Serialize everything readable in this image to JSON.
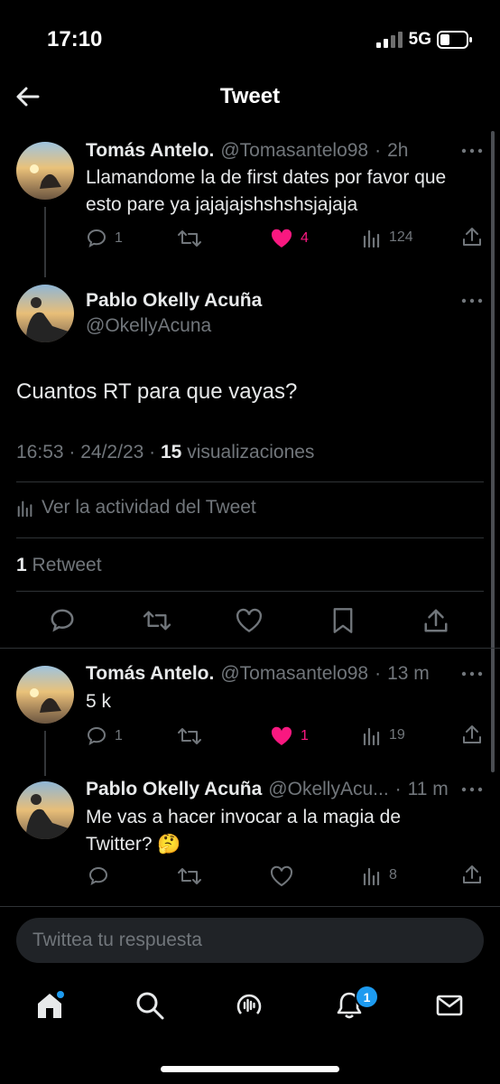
{
  "status": {
    "time": "17:10",
    "network": "5G"
  },
  "header": {
    "title": "Tweet"
  },
  "tweet1": {
    "name": "Tomás Antelo.",
    "handle": "@Tomasantelo98",
    "sep": "·",
    "time": "2h",
    "text": "Llamandome la de first dates por favor que esto pare ya jajajajshshshsjajaja",
    "replies": "1",
    "likes": "4",
    "views": "124"
  },
  "main": {
    "name": "Pablo Okelly Acuña",
    "handle": "@OkellyAcuna",
    "text": "Cuantos RT para que vayas?",
    "time": "16:53",
    "date": "24/2/23",
    "views_count": "15",
    "views_label": "visualizaciones",
    "activity": "Ver la actividad del Tweet",
    "retweets_count": "1",
    "retweets_label": "Retweet"
  },
  "reply1": {
    "name": "Tomás Antelo.",
    "handle": "@Tomasantelo98",
    "time": "13 m",
    "text": "5 k",
    "replies": "1",
    "likes": "1",
    "views": "19"
  },
  "reply2": {
    "name": "Pablo Okelly Acuña",
    "handle": "@OkellyAcu...",
    "time": "11 m",
    "text": "Me vas a hacer invocar a la magia de Twitter? 🤔",
    "views": "8"
  },
  "composer": {
    "placeholder": "Twittea tu respuesta"
  },
  "nav": {
    "notifications_badge": "1"
  },
  "colors": {
    "like": "#f91880",
    "accent": "#1d9bf0",
    "muted": "#71767b"
  }
}
